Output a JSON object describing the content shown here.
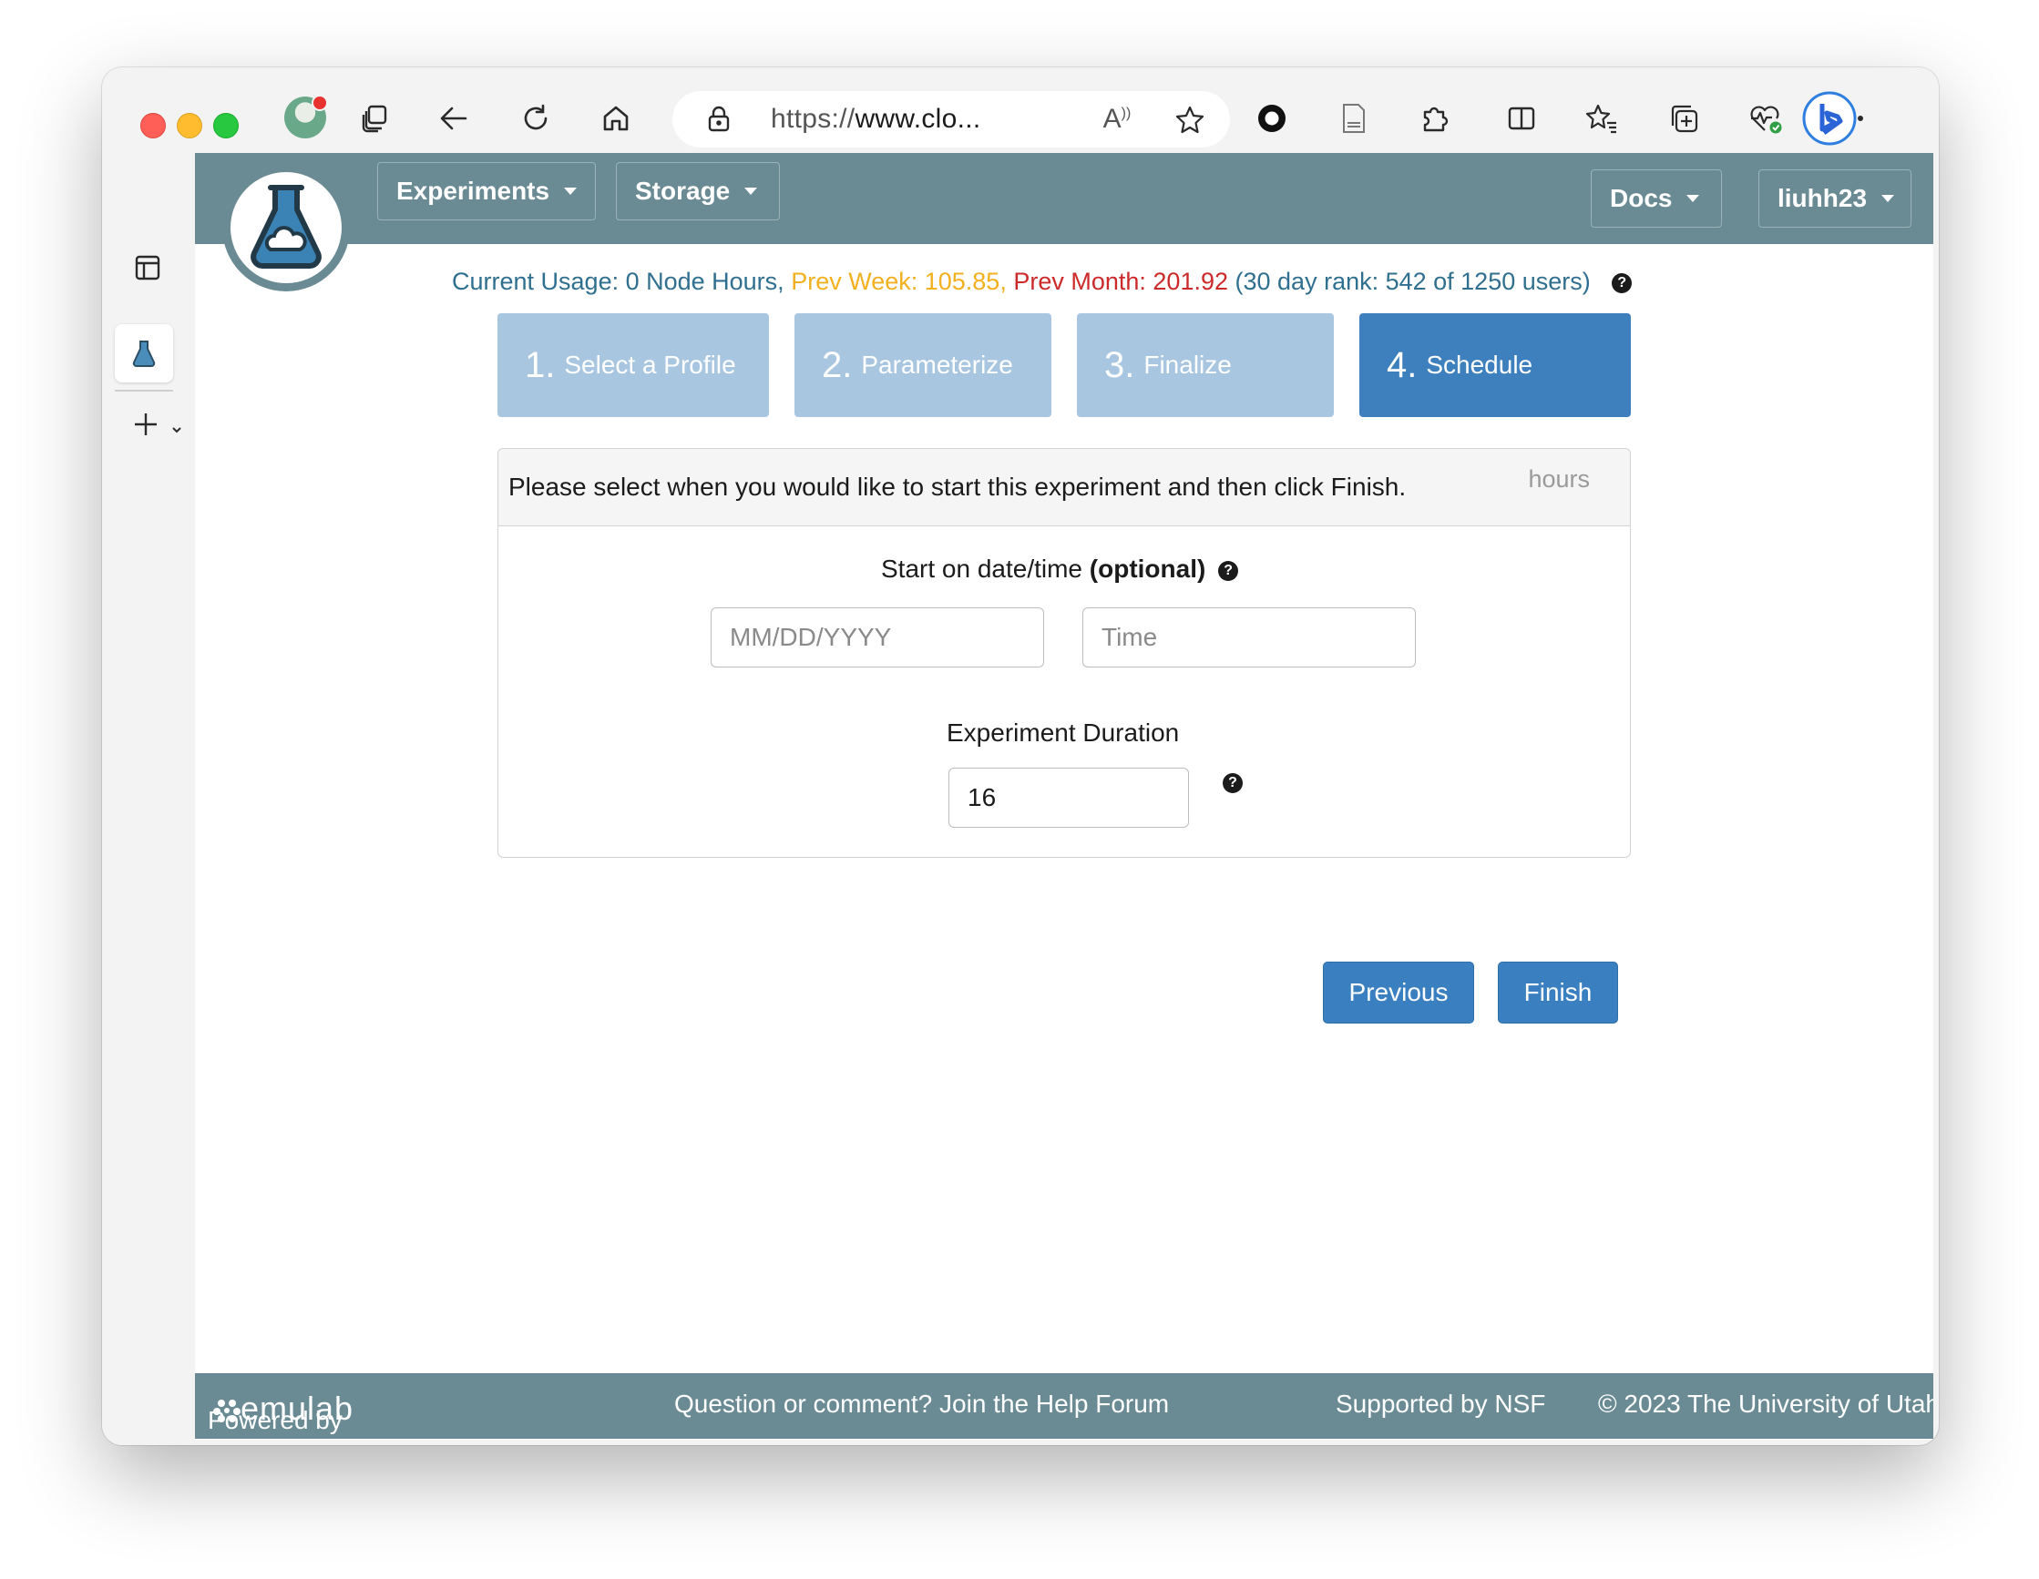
{
  "browser": {
    "url_prefix": "https://",
    "url_rest": "www.clo...",
    "read_aloud_label": "A"
  },
  "nav": {
    "experiments": "Experiments",
    "storage": "Storage",
    "docs": "Docs",
    "user": "liuhh23"
  },
  "usage": {
    "current": "Current Usage: 0 Node Hours,",
    "prev_week": "Prev Week: 105.85,",
    "prev_month": "Prev Month: 201.92",
    "rank": "(30 day rank: 542 of 1250 users)"
  },
  "steps": [
    {
      "num": "1.",
      "label": "Select a Profile"
    },
    {
      "num": "2.",
      "label": "Parameterize"
    },
    {
      "num": "3.",
      "label": "Finalize"
    },
    {
      "num": "4.",
      "label": "Schedule"
    }
  ],
  "panel": {
    "instruction": "Please select when you would like to start this experiment and then click Finish.",
    "hours": "hours",
    "start_label": "Start on date/time",
    "start_optional": "(optional)",
    "date_placeholder": "MM/DD/YYYY",
    "time_placeholder": "Time",
    "duration_label": "Experiment Duration",
    "duration_value": "16"
  },
  "buttons": {
    "previous": "Previous",
    "finish": "Finish"
  },
  "footer": {
    "powered_by": "Powered by",
    "brand": "emulab",
    "help": "Question or comment? Join the Help Forum",
    "nsf": "Supported by NSF",
    "copyright": "© 2023 The University of Utah"
  },
  "colors": {
    "navbar": "#6a8b93",
    "step_inactive": "#a8c6e0",
    "step_active": "#3e80bd",
    "button": "#3a7fc0",
    "usage_text": "#2f6f90",
    "prev_week": "#f2b01e",
    "prev_month": "#cc2a2a"
  },
  "icons": [
    "avatar",
    "tabs-icon",
    "back-icon",
    "refresh-icon",
    "home-icon",
    "lock-icon",
    "read-aloud-icon",
    "favorite-star-icon",
    "record-icon",
    "document-icon",
    "extensions-icon",
    "split-screen-icon",
    "favorites-icon",
    "collections-icon",
    "health-icon",
    "more-icon",
    "bing-icon",
    "sidebar-toggle-icon",
    "flask-tab-icon",
    "new-tab-icon"
  ]
}
